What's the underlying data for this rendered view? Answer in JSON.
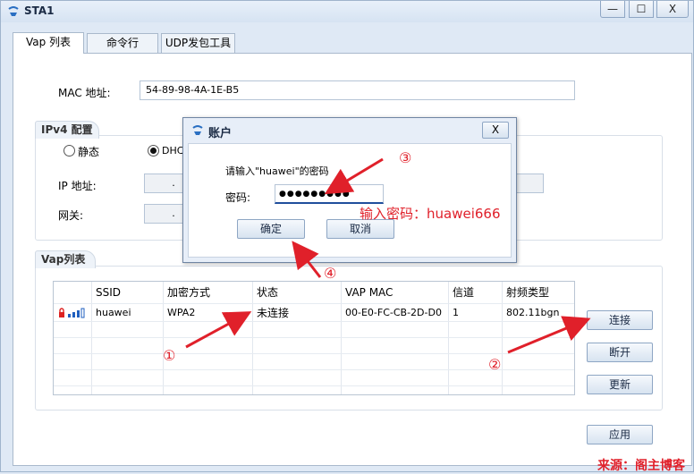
{
  "window": {
    "title": "STA1",
    "min_label": "—",
    "max_label": "☐",
    "close_label": "X"
  },
  "tabs": [
    {
      "label": "Vap 列表"
    },
    {
      "label": "命令行"
    },
    {
      "label": "UDP发包工具"
    }
  ],
  "mac": {
    "label": "MAC 地址:",
    "value": "54-89-98-4A-1E-B5"
  },
  "ipv4": {
    "title": "IPv4 配置",
    "static_label": "静态",
    "dhcp_label": "DHCP",
    "ip_label": "IP 地址:",
    "gateway_label": "网关:",
    "dot": "."
  },
  "vap": {
    "title": "Vap列表",
    "columns": [
      "SSID",
      "加密方式",
      "状态",
      "VAP MAC",
      "信道",
      "射频类型"
    ],
    "rows": [
      {
        "ssid": "huawei",
        "enc": "WPA2",
        "status": "未连接",
        "mac": "00-E0-FC-CB-2D-D0",
        "channel": "1",
        "radio": "802.11bgn"
      }
    ],
    "connect_label": "连接",
    "disconnect_label": "断开",
    "refresh_label": "更新"
  },
  "apply_label": "应用",
  "dialog": {
    "title": "账户",
    "close_label": "X",
    "prompt": "请输入\"huawei\"的密码",
    "password_label": "密码:",
    "password_value": "●●●●●●●●●",
    "ok_label": "确定",
    "cancel_label": "取消"
  },
  "annotations": {
    "n1": "①",
    "n2": "②",
    "n3": "③",
    "n4": "④",
    "hint": "输入密码：huawei666",
    "watermark": "来源：阁主博客"
  },
  "colors": {
    "annotation": "#e0202a",
    "accent": "#1f4e9c"
  }
}
